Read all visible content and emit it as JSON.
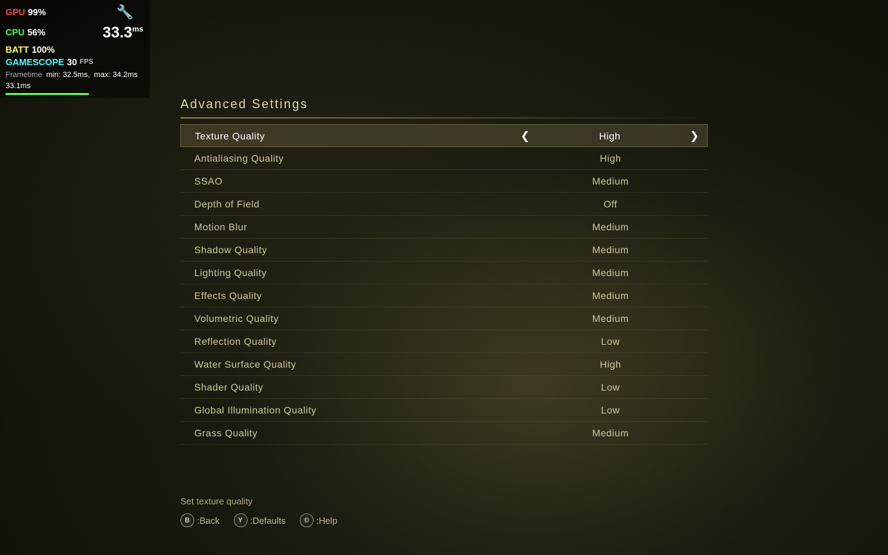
{
  "hud": {
    "gpu_label": "GPU",
    "gpu_val": "99%",
    "cpu_label": "CPU",
    "cpu_val": "56%",
    "batt_label": "BATT",
    "batt_val": "100%",
    "gamescope_label": "GAMESCOPE",
    "fps_val": "30",
    "fps_unit": "FPS",
    "ms_val": "33.3",
    "ms_unit": "ms",
    "frametime_label": "Frametime",
    "frametime_min": "min: 32.5ms,",
    "frametime_max": "max: 34.2ms",
    "frametime_current": "33.1ms"
  },
  "page": {
    "title": "Advanced Settings",
    "title_underline": true
  },
  "settings": {
    "rows": [
      {
        "label": "Texture Quality",
        "value": "High",
        "has_arrows": true,
        "selected": true
      },
      {
        "label": "Antialiasing Quality",
        "value": "High",
        "has_arrows": false
      },
      {
        "label": "SSAO",
        "value": "Medium",
        "has_arrows": false
      },
      {
        "label": "Depth of Field",
        "value": "Off",
        "has_arrows": false
      },
      {
        "label": "Motion Blur",
        "value": "Medium",
        "has_arrows": false
      },
      {
        "label": "Shadow Quality",
        "value": "Medium",
        "has_arrows": false
      },
      {
        "label": "Lighting Quality",
        "value": "Medium",
        "has_arrows": false
      },
      {
        "label": "Effects Quality",
        "value": "Medium",
        "has_arrows": false
      },
      {
        "label": "Volumetric Quality",
        "value": "Medium",
        "has_arrows": false
      },
      {
        "label": "Reflection Quality",
        "value": "Low",
        "has_arrows": false
      },
      {
        "label": "Water Surface Quality",
        "value": "High",
        "has_arrows": false
      },
      {
        "label": "Shader Quality",
        "value": "Low",
        "has_arrows": false
      },
      {
        "label": "Global Illumination Quality",
        "value": "Low",
        "has_arrows": false
      },
      {
        "label": "Grass Quality",
        "value": "Medium",
        "has_arrows": false
      }
    ]
  },
  "bottom": {
    "hint": "Set texture quality",
    "controls": [
      {
        "icon": "B",
        "label": ":Back"
      },
      {
        "icon": "Y",
        "label": ":Defaults"
      },
      {
        "icon": "©",
        "label": ":Help"
      }
    ]
  }
}
